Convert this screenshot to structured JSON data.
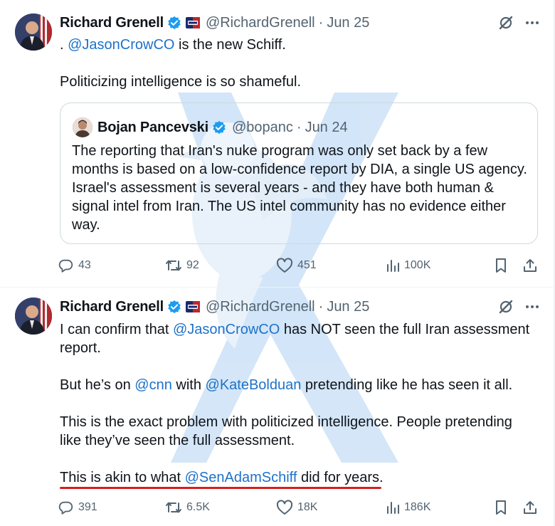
{
  "tweets": [
    {
      "author_name": "Richard Grenell",
      "handle": "@RichardGrenell",
      "separator": "·",
      "date": "Jun 25",
      "text_lines": {
        "l1_prefix": ". ",
        "l1_link": "@JasonCrowCO",
        "l1_suffix": " is the new Schiff.",
        "l2": "Politicizing intelligence is so shameful."
      },
      "quote": {
        "author_name": "Bojan Pancevski",
        "handle": "@bopanc",
        "separator": "·",
        "date": "Jun 24",
        "text": "The reporting that Iran's nuke program was only set back by a few months is based on a low-confidence report by DIA, a single US agency. Israel's assessment is several years - and they have both human & signal intel from Iran. The US intel community has no evidence either way."
      },
      "stats": {
        "replies": "43",
        "reposts": "92",
        "likes": "451",
        "views": "100K"
      }
    },
    {
      "author_name": "Richard Grenell",
      "handle": "@RichardGrenell",
      "separator": "·",
      "date": "Jun 25",
      "paragraphs": {
        "p1_a": "I can confirm that ",
        "p1_link": "@JasonCrowCO",
        "p1_b": " has NOT seen the full Iran assessment report.",
        "p2_a": "But he’s on ",
        "p2_link1": "@cnn",
        "p2_b": " with ",
        "p2_link2": "@KateBolduan",
        "p2_c": " pretending like he has seen it all.",
        "p3": "This is the exact problem with politicized intelligence. People pretending like they’ve seen the full assessment.",
        "p4_a": "This is akin to what ",
        "p4_link": "@SenAdamSchiff",
        "p4_b": " did for years."
      },
      "stats": {
        "replies": "391",
        "reposts": "6.5K",
        "likes": "18K",
        "views": "186K"
      }
    }
  ],
  "icons": {
    "verified": "verified-badge-icon",
    "affiliate": "affiliate-flag-icon",
    "grok": "grok-icon",
    "more": "more-icon",
    "reply": "reply-icon",
    "repost": "repost-icon",
    "like": "like-icon",
    "views": "views-icon",
    "bookmark": "bookmark-icon",
    "share": "share-icon"
  },
  "colors": {
    "link": "#1d72c9",
    "verified": "#1d9bf0",
    "muted": "#536471",
    "underline": "#d81e1e"
  }
}
